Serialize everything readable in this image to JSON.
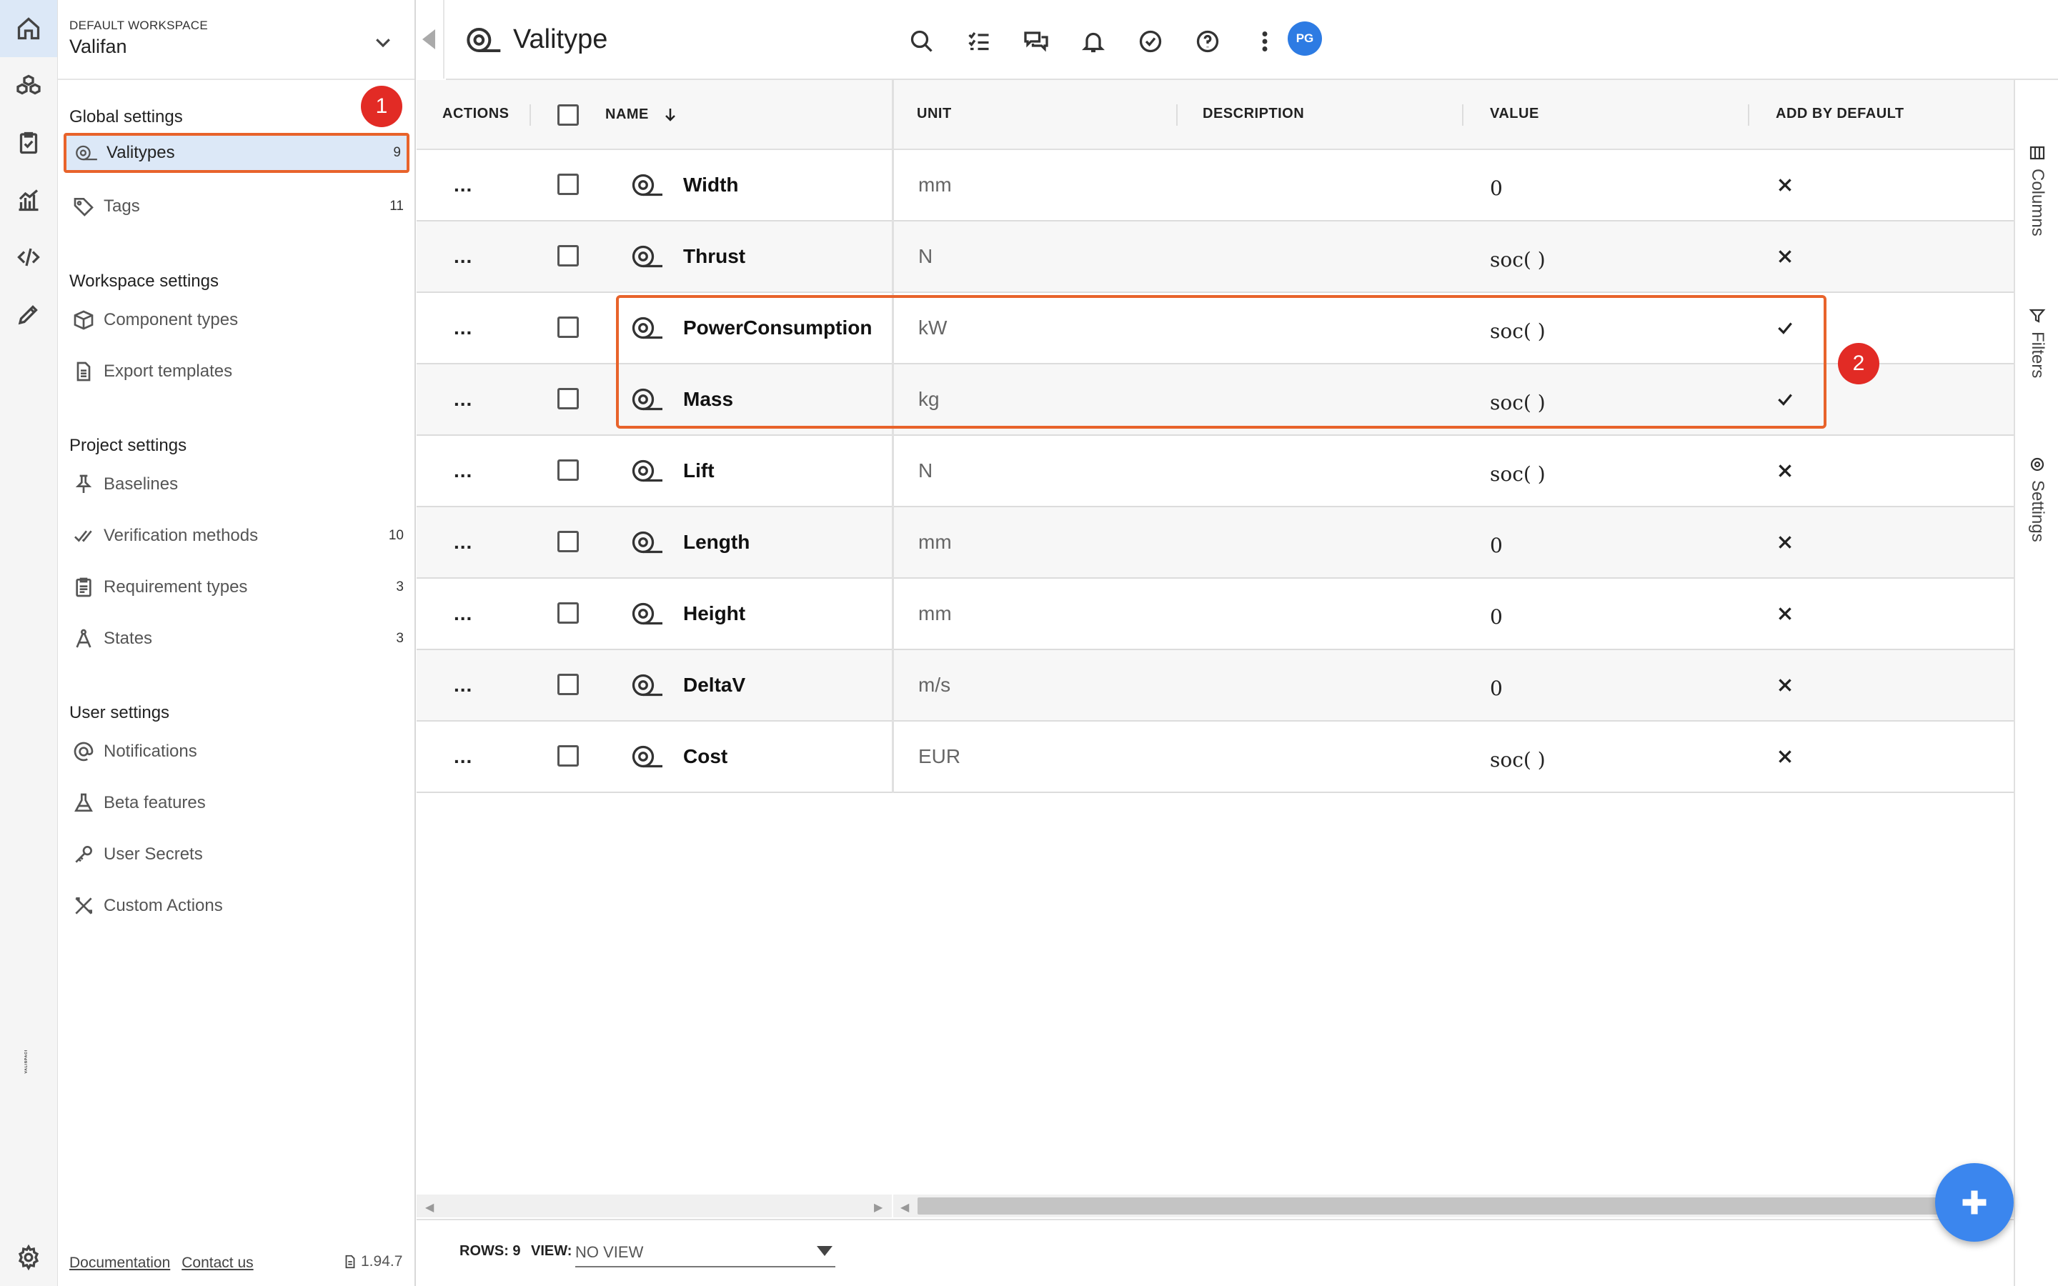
{
  "workspace": {
    "label": "DEFAULT WORKSPACE",
    "name": "Valifan"
  },
  "sidebar": {
    "sections": {
      "global": "Global settings",
      "workspace": "Workspace settings",
      "project": "Project settings",
      "user": "User settings"
    },
    "items": [
      {
        "label": "Valitypes",
        "count": "9",
        "icon": "valitype-icon"
      },
      {
        "label": "Tags",
        "count": "11",
        "icon": "tag-icon"
      },
      {
        "label": "Component types",
        "count": "",
        "icon": "box-icon"
      },
      {
        "label": "Export templates",
        "count": "",
        "icon": "document-icon"
      },
      {
        "label": "Baselines",
        "count": "",
        "icon": "pin-icon"
      },
      {
        "label": "Verification methods",
        "count": "10",
        "icon": "check-double-icon"
      },
      {
        "label": "Requirement types",
        "count": "3",
        "icon": "clipboard-icon"
      },
      {
        "label": "States",
        "count": "3",
        "icon": "compass-icon"
      },
      {
        "label": "Notifications",
        "count": "",
        "icon": "at-icon"
      },
      {
        "label": "Beta features",
        "count": "",
        "icon": "flask-icon"
      },
      {
        "label": "User Secrets",
        "count": "",
        "icon": "key-icon"
      },
      {
        "label": "Custom Actions",
        "count": "",
        "icon": "tools-icon"
      }
    ],
    "footer": {
      "documentation": "Documentation",
      "contact": "Contact us",
      "version": "1.94.7"
    }
  },
  "header": {
    "title": "Valitype",
    "avatar": "PG"
  },
  "table": {
    "columns": {
      "actions": "ACTIONS",
      "name": "NAME",
      "unit": "UNIT",
      "description": "DESCRIPTION",
      "value": "VALUE",
      "add_by_default": "ADD BY DEFAULT"
    },
    "rows": [
      {
        "name": "Width",
        "unit": "mm",
        "value": "0",
        "default": false
      },
      {
        "name": "Thrust",
        "unit": "N",
        "value": "soc( )",
        "default": false
      },
      {
        "name": "PowerConsumption",
        "unit": "kW",
        "value": "soc( )",
        "default": true
      },
      {
        "name": "Mass",
        "unit": "kg",
        "value": "soc( )",
        "default": true
      },
      {
        "name": "Lift",
        "unit": "N",
        "value": "soc( )",
        "default": false
      },
      {
        "name": "Length",
        "unit": "mm",
        "value": "0",
        "default": false
      },
      {
        "name": "Height",
        "unit": "mm",
        "value": "0",
        "default": false
      },
      {
        "name": "DeltaV",
        "unit": "m/s",
        "value": "0",
        "default": false
      },
      {
        "name": "Cost",
        "unit": "EUR",
        "value": "soc( )",
        "default": false
      }
    ],
    "actions_glyph": "..."
  },
  "status_bar": {
    "rows_label": "ROWS: 9",
    "view_label": "VIEW:",
    "view_value": "NO VIEW"
  },
  "right_panel": {
    "columns": "Columns",
    "filters": "Filters",
    "settings": "Settings"
  },
  "annotations": {
    "badge1": "1",
    "badge2": "2"
  },
  "colors": {
    "accent": "#2d7be3",
    "highlight": "#e8632b",
    "badge": "#e22b25",
    "selected_bg": "#dce8f7"
  }
}
